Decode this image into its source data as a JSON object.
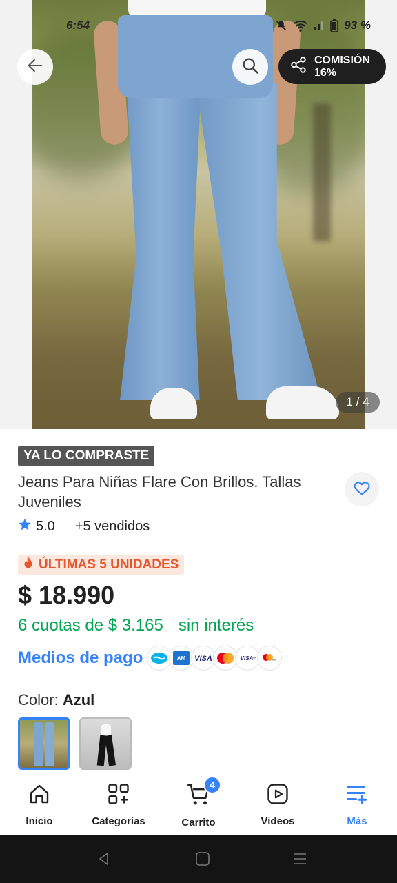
{
  "status_bar": {
    "time": "6:54",
    "battery": "93 %"
  },
  "hero": {
    "pager": "1 / 4",
    "commission_line1": "COMISIÓN",
    "commission_line2": "16%"
  },
  "product": {
    "bought_badge": "YA LO COMPRASTE",
    "title": "Jeans Para Niñas Flare Con Brillos. Tallas Juveniles",
    "rating": "5.0",
    "sold": "+5 vendidos",
    "scarcity": "ÚLTIMAS 5 UNIDADES",
    "price": "$ 18.990",
    "installments": "6 cuotas de $ 3.165",
    "interest": "sin interés",
    "payment_link": "Medios de pago",
    "payment_icons": [
      "mercadopago-icon",
      "amex-icon",
      "visa-icon",
      "mastercard-icon",
      "visa-debit-icon",
      "mastercard-debit-icon"
    ],
    "color_label": "Color:",
    "color_value": "Azul"
  },
  "nav": {
    "items": [
      {
        "label": "Inicio",
        "icon": "home-icon"
      },
      {
        "label": "Categorías",
        "icon": "categories-icon"
      },
      {
        "label": "Carrito",
        "icon": "cart-icon"
      },
      {
        "label": "Videos",
        "icon": "video-icon"
      },
      {
        "label": "Más",
        "icon": "menu-plus-icon"
      }
    ],
    "cart_count": "4"
  },
  "colors": {
    "accent": "#3483fa",
    "green": "#00a650",
    "orange": "#e4572e"
  }
}
